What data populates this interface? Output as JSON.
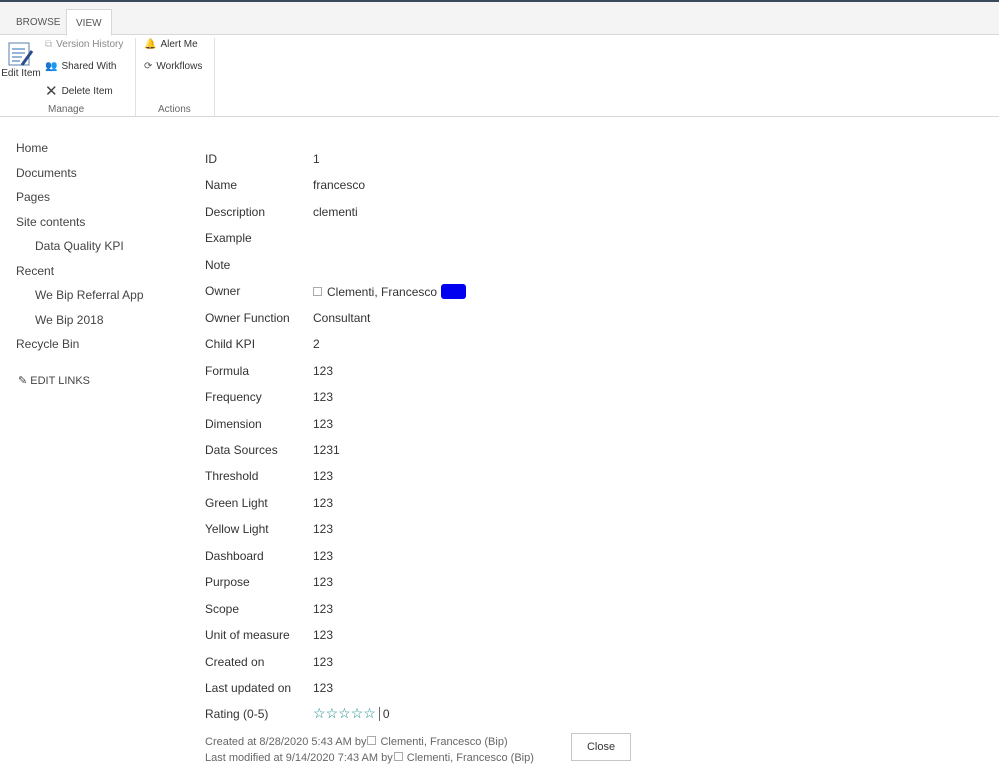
{
  "ribbon": {
    "tabs": [
      "BROWSE",
      "VIEW"
    ],
    "edit_item": "Edit Item",
    "version_history": "Version History",
    "shared_with": "Shared With",
    "delete_item": "Delete Item",
    "manage": "Manage",
    "alert_me": "Alert Me",
    "workflows": "Workflows",
    "actions": "Actions"
  },
  "nav": {
    "home": "Home",
    "documents": "Documents",
    "pages": "Pages",
    "site_contents": "Site contents",
    "dq_kpi": "Data Quality KPI",
    "recent": "Recent",
    "referral": "We Bip Referral App",
    "bip2018": "We Bip 2018",
    "recycle": "Recycle Bin",
    "edit_links": "EDIT LINKS"
  },
  "fields": [
    {
      "label": "ID",
      "value": "1"
    },
    {
      "label": "Name",
      "value": "francesco"
    },
    {
      "label": "Description",
      "value": "clementi"
    },
    {
      "label": "Example",
      "value": ""
    },
    {
      "label": "Note",
      "value": ""
    },
    {
      "label": "Owner",
      "value": "Clementi, Francesco"
    },
    {
      "label": "Owner Function",
      "value": "Consultant"
    },
    {
      "label": "Child KPI",
      "value": "2"
    },
    {
      "label": "Formula",
      "value": "123"
    },
    {
      "label": "Frequency",
      "value": "123"
    },
    {
      "label": "Dimension",
      "value": "123"
    },
    {
      "label": "Data Sources",
      "value": "1231"
    },
    {
      "label": "Threshold",
      "value": "123"
    },
    {
      "label": "Green Light",
      "value": "123"
    },
    {
      "label": "Yellow Light",
      "value": "123"
    },
    {
      "label": "Dashboard",
      "value": "123"
    },
    {
      "label": "Purpose",
      "value": "123"
    },
    {
      "label": "Scope",
      "value": "123"
    },
    {
      "label": "Unit of measure",
      "value": "123"
    },
    {
      "label": "Created on",
      "value": "123"
    },
    {
      "label": "Last updated on",
      "value": "123"
    },
    {
      "label": "Rating (0-5)",
      "value": "0"
    }
  ],
  "rating": {
    "value": 0,
    "max": 5,
    "color": "#1a8a8a"
  },
  "footer": {
    "created": "Created at 8/28/2020 5:43 AM  by",
    "created_by": "Clementi, Francesco (Bip)",
    "modified": "Last modified at 9/14/2020 7:43 AM  by",
    "modified_by": "Clementi, Francesco (Bip)",
    "close": "Close"
  }
}
